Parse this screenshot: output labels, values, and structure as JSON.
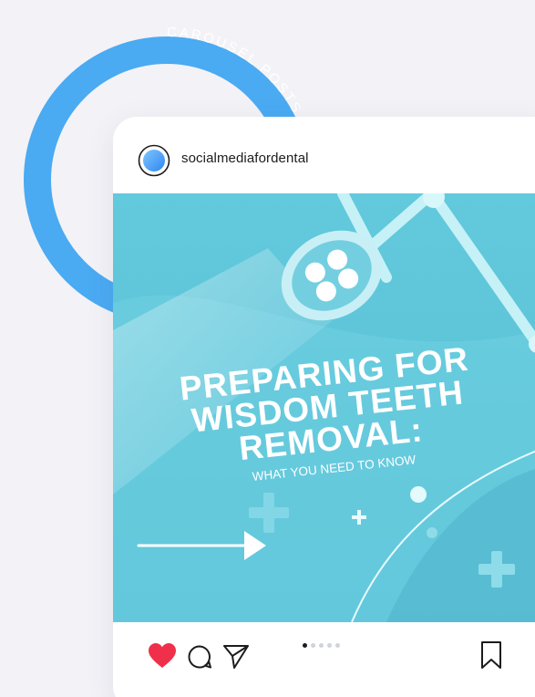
{
  "badge": {
    "ring_text": "CAROUSEL POSTS  CAROUSEL POSTS  CAROUSEL POSTS  ",
    "ring_color": "#4aaaf2"
  },
  "post": {
    "username": "socialmediafordental",
    "image": {
      "title_lines": [
        "PREPARING FOR",
        "WISDOM TEETH",
        "REMOVAL:"
      ],
      "subtitle": "WHAT YOU NEED TO KNOW",
      "background_color": "#5ec5d8"
    },
    "carousel": {
      "total_slides": 5,
      "active_index": 0
    },
    "actions": {
      "liked": true,
      "like_icon": "heart-icon",
      "comment_icon": "comment-icon",
      "share_icon": "send-icon",
      "save_icon": "bookmark-icon",
      "like_color": "#f0304a"
    }
  }
}
